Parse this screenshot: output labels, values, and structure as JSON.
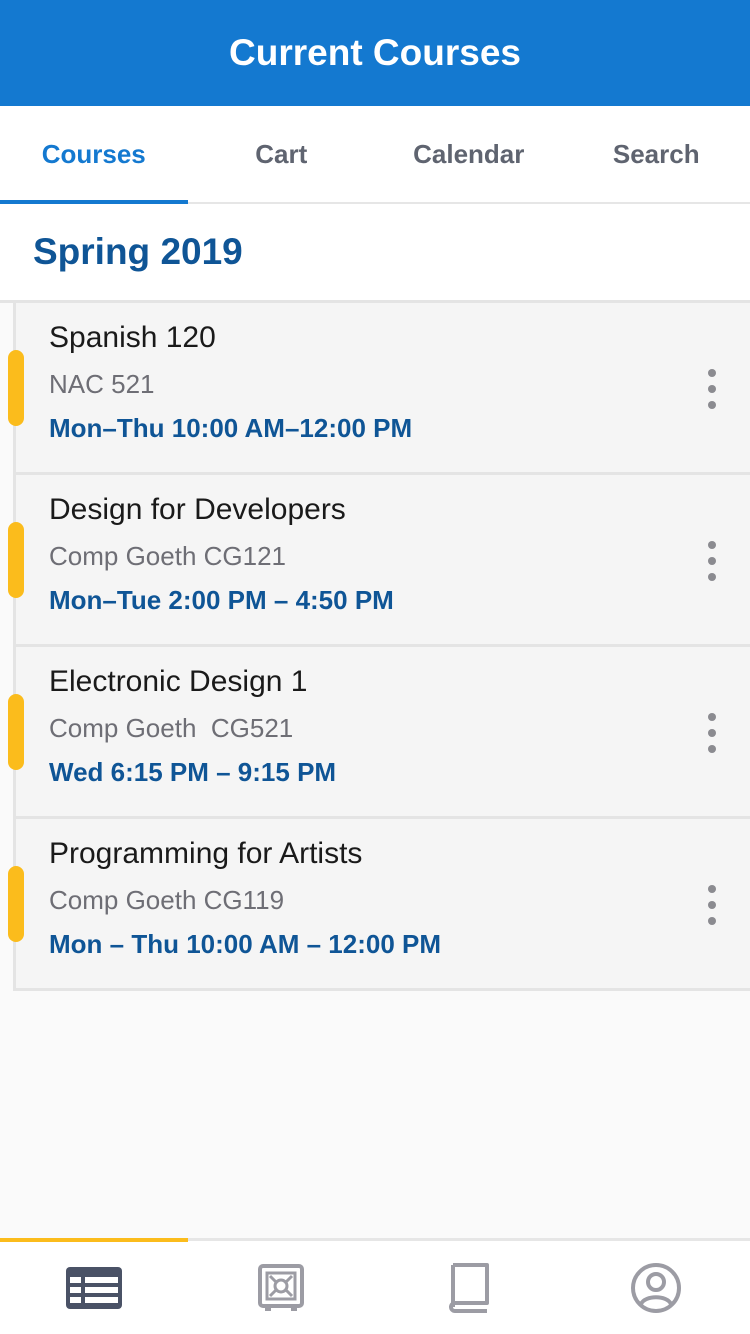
{
  "header": {
    "title": "Current Courses"
  },
  "tabs": [
    {
      "label": "Courses",
      "active": true
    },
    {
      "label": "Cart",
      "active": false
    },
    {
      "label": "Calendar",
      "active": false
    },
    {
      "label": "Search",
      "active": false
    }
  ],
  "term": {
    "label": "Spring 2019"
  },
  "courses": [
    {
      "title": "Spanish 120",
      "location": "NAC 521",
      "time": "Mon–Thu 10:00 AM–12:00 PM"
    },
    {
      "title": "Design for Developers",
      "location": "Comp Goeth CG121",
      "time": "Mon–Tue 2:00 PM – 4:50 PM"
    },
    {
      "title": "Electronic Design 1",
      "location": "Comp Goeth  CG521",
      "time": "Wed 6:15 PM – 9:15 PM"
    },
    {
      "title": "Programming for Artists",
      "location": "Comp Goeth CG119",
      "time": "Mon – Thu 10:00 AM – 12:00 PM"
    }
  ],
  "bottom_nav": [
    {
      "icon": "course-list-icon",
      "active": true
    },
    {
      "icon": "safe-icon",
      "active": false
    },
    {
      "icon": "book-icon",
      "active": false
    },
    {
      "icon": "profile-icon",
      "active": false
    }
  ],
  "colors": {
    "primary": "#1479d0",
    "dark_blue": "#0f5596",
    "accent_yellow": "#fbbc1c"
  }
}
